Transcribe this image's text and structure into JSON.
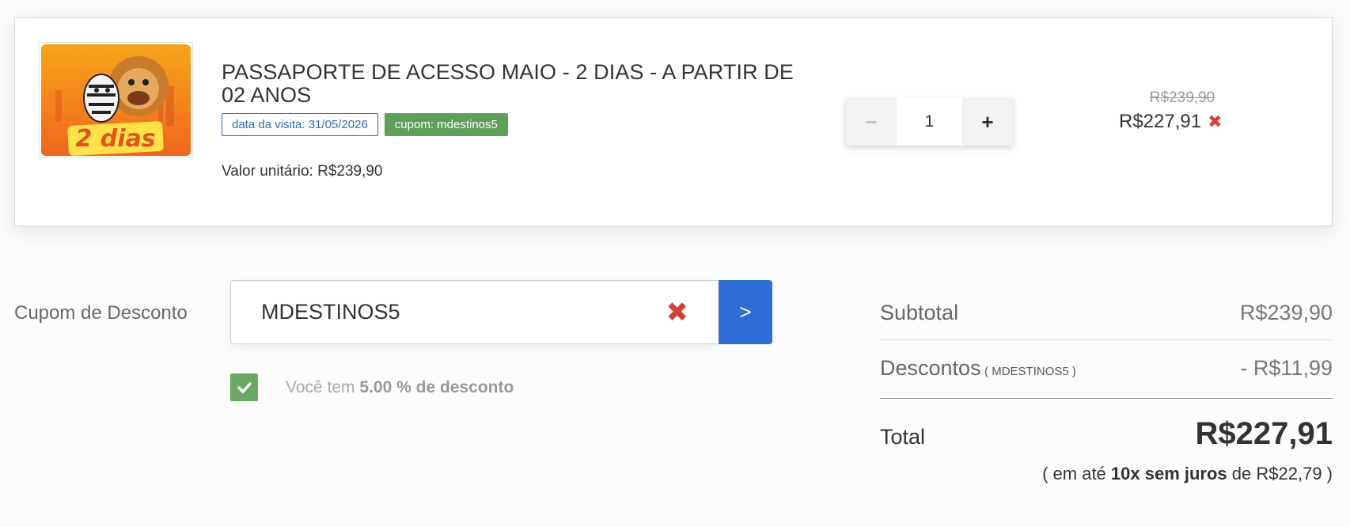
{
  "cart_item": {
    "thumbnail_text": "2 dias",
    "title": "PASSAPORTE DE ACESSO MAIO - 2 DIAS - A PARTIR DE 02 ANOS",
    "visit_date_tag": "data da visita: 31/05/2026",
    "coupon_tag": "cupom: mdestinos5",
    "unit_price": "Valor unitário: R$239,90",
    "quantity": "1",
    "minus_label": "−",
    "plus_label": "+",
    "price_old": "R$239,90",
    "price_new": "R$227,91",
    "remove_label": "✖"
  },
  "coupon": {
    "label": "Cupom de Desconto",
    "value": "MDESTINOS5",
    "clear_label": "✖",
    "submit_label": ">",
    "message_prefix": "Você tem",
    "message_strong": "5.00 % de desconto"
  },
  "summary": {
    "subtotal_label": "Subtotal",
    "subtotal_value": "R$239,90",
    "discount_label": "Descontos",
    "discount_code": "( MDESTINOS5 )",
    "discount_value": "- R$11,99",
    "total_label": "Total",
    "total_value": "R$227,91",
    "installments_open": "( em até",
    "installments_strong": "10x sem juros",
    "installments_close": "de R$22,79 )"
  },
  "colors": {
    "accent_blue": "#2d6fd6",
    "success_green": "#5e9f5a",
    "danger_red": "#d0433b"
  }
}
